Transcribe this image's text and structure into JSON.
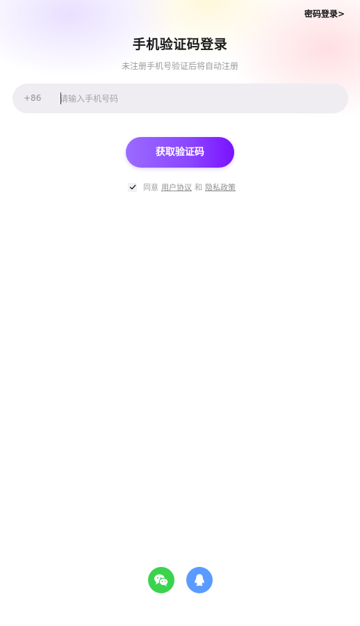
{
  "header": {
    "password_login": "密码登录>"
  },
  "main": {
    "title": "手机验证码登录",
    "subtitle": "未注册手机号验证后将自动注册",
    "phone": {
      "prefix": "+86",
      "placeholder": "请输入手机号码",
      "value": ""
    },
    "get_code_label": "获取验证码",
    "agreement": {
      "checked": true,
      "prefix": "同意",
      "user_agreement": "用户协议",
      "and": "和",
      "privacy_policy": "隐私政策"
    }
  },
  "social_login": {
    "items": [
      {
        "icon": "wechat-icon",
        "color": "#3bd34e"
      },
      {
        "icon": "qq-icon",
        "color": "#5a9bff"
      }
    ]
  },
  "colors": {
    "accent_start": "#9a6bff",
    "accent_end": "#7a12ff",
    "input_bg": "#efedf2"
  }
}
